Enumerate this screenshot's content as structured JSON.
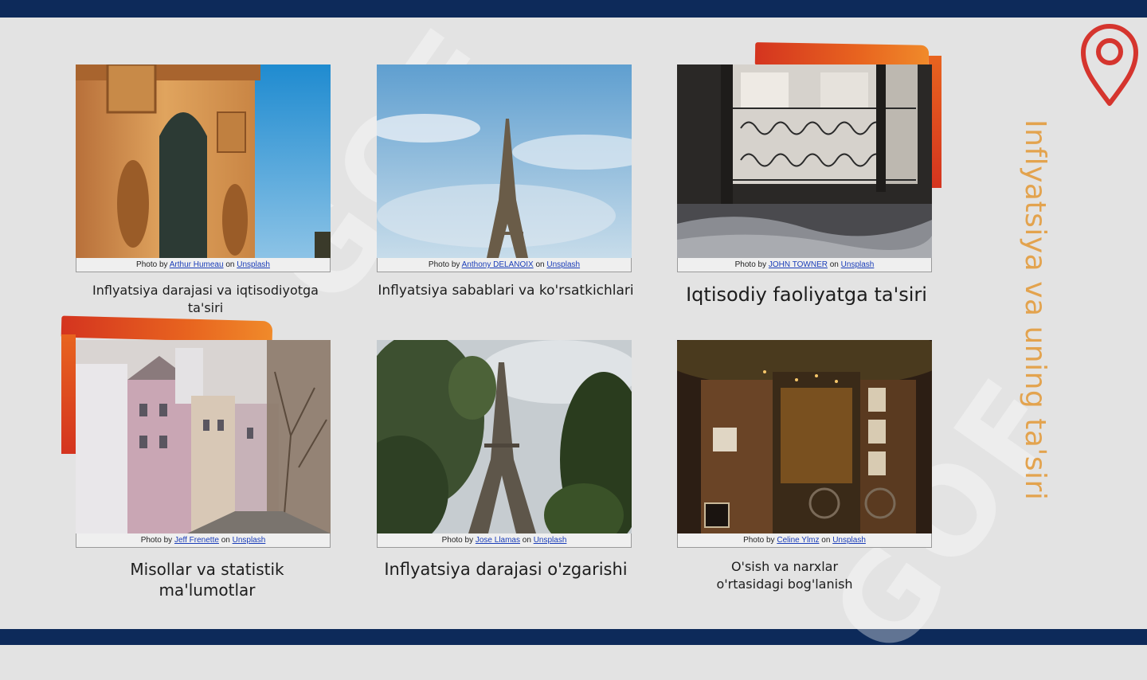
{
  "slide": {
    "title": "Inflyatsiya va uning ta'siri",
    "accent_color": "#e3a34e",
    "frame_color": "#0d2a5a",
    "icon": "location-pin-icon"
  },
  "cards": [
    {
      "caption": "Inflyatsiya darajasi va iqtisodiyotga ta'siri",
      "credit_prefix": "Photo by",
      "author": "Arthur Humeau",
      "on": "on",
      "source": "Unsplash"
    },
    {
      "caption": "Inflyatsiya sabablari va ko'rsatkichlari",
      "credit_prefix": "Photo by",
      "author": "Anthony DELANOIX",
      "on": "on",
      "source": "Unsplash"
    },
    {
      "caption": "Iqtisodiy faoliyatga ta'siri",
      "credit_prefix": "Photo by",
      "author": "JOHN TOWNER",
      "on": "on",
      "source": "Unsplash"
    },
    {
      "caption": "Misollar va statistik ma'lumotlar",
      "credit_prefix": "Photo by",
      "author": "Jeff Frenette",
      "on": "on",
      "source": "Unsplash"
    },
    {
      "caption": "Inflyatsiya darajasi o'zgarishi",
      "credit_prefix": "Photo by",
      "author": "Jose Llamas",
      "on": "on",
      "source": "Unsplash"
    },
    {
      "caption": "O'sish va narxlar o'rtasidagi bog'lanish",
      "credit_prefix": "Photo by",
      "author": "Celine Ylmz",
      "on": "on",
      "source": "Unsplash"
    }
  ]
}
